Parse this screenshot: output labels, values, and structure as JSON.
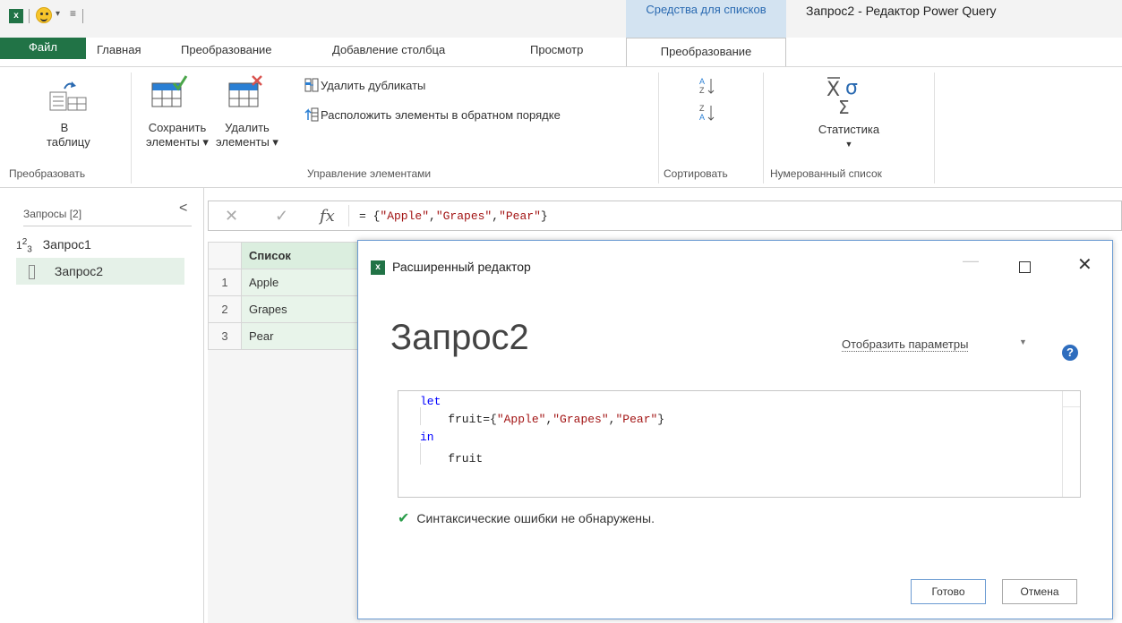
{
  "titlebar": {
    "app_badge": "x",
    "context_tab": "Средства для списков",
    "window_title": "Запрос2 - Редактор Power Query"
  },
  "tabs": {
    "file": "Файл",
    "home": "Главная",
    "transform": "Преобразование",
    "add_column": "Добавление столбца",
    "view": "Просмотр",
    "list_transform": "Преобразование"
  },
  "ribbon": {
    "to_table_line1": "В",
    "to_table_line2": "таблицу",
    "keep_items_line1": "Сохранить",
    "keep_items_line2": "элементы ▾",
    "remove_items_line1": "Удалить",
    "remove_items_line2": "элементы ▾",
    "remove_duplicates": "Удалить дубликаты",
    "reverse_items": "Расположить элементы в обратном порядке",
    "statistics": "Статистика",
    "group_convert": "Преобразовать",
    "group_manage_items": "Управление элементами",
    "group_sort": "Сортировать",
    "group_numbered_list": "Нумерованный список"
  },
  "queries": {
    "header": "Запросы [2]",
    "items": [
      {
        "icon": "123",
        "label": "Запрос1"
      },
      {
        "icon": "list",
        "label": "Запрос2"
      }
    ]
  },
  "formula_bar": {
    "prefix": "= {",
    "s1": "\"Apple\"",
    "s2": "\"Grapes\"",
    "s3": "\"Pear\"",
    "suffix": "}"
  },
  "grid": {
    "header": "Список",
    "rows": [
      {
        "n": "1",
        "value": "Apple"
      },
      {
        "n": "2",
        "value": "Grapes"
      },
      {
        "n": "3",
        "value": "Pear"
      }
    ]
  },
  "dialog": {
    "title": "Расширенный редактор",
    "heading": "Запрос2",
    "params": "Отобразить параметры",
    "help": "?",
    "code": {
      "l1_kw": "let",
      "l2_pre": "    fruit={",
      "l2_s1": "\"Apple\"",
      "l2_s2": "\"Grapes\"",
      "l2_s3": "\"Pear\"",
      "l2_post": "}",
      "l3_kw": "in",
      "l4": "    fruit"
    },
    "status": "Синтаксические ошибки не обнаружены.",
    "ok": "Готово",
    "cancel": "Отмена"
  },
  "colors": {
    "excel_green": "#217346",
    "context_tab_bg": "#d3e3f1",
    "selection_green": "#e5f1e8",
    "string_color": "#a31515",
    "keyword_color": "#0000ff"
  }
}
